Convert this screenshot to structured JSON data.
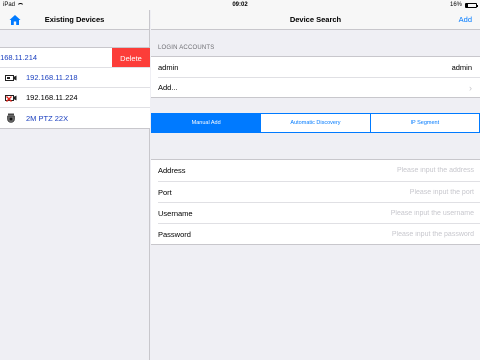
{
  "status_bar": {
    "carrier": "iPad",
    "time": "09:02",
    "battery": "16%",
    "battery_level": 0.16
  },
  "left": {
    "title": "Existing Devices",
    "devices": [
      {
        "label": ".168.11.214",
        "icon": "device-icon",
        "swiped": true,
        "delete_label": "Delete"
      },
      {
        "label": "192.168.11.218",
        "icon": "camera-icon"
      },
      {
        "label": "192.168.11.224",
        "icon": "camera-offline-icon"
      },
      {
        "label": "2M PTZ 22X",
        "icon": "ptz-dome-icon"
      }
    ]
  },
  "right": {
    "title": "Device Search",
    "add_label": "Add",
    "login_accounts": {
      "header": "LOGIN ACCOUNTS",
      "account_name": "admin",
      "account_value": "admin",
      "add_label": "Add..."
    },
    "segments": [
      {
        "label": "Manual Add",
        "active": true
      },
      {
        "label": "Automatic Discovery",
        "active": false
      },
      {
        "label": "IP Segment",
        "active": false
      }
    ],
    "form": {
      "address_label": "Address",
      "address_placeholder": "Please input the address",
      "port_label": "Port",
      "port_placeholder": "Please input the port",
      "username_label": "Username",
      "username_placeholder": "Please input the username",
      "password_label": "Password",
      "password_placeholder": "Please input the password"
    }
  },
  "colors": {
    "accent": "#007aff",
    "delete": "#fc3d39",
    "device_link": "#1a3fbf"
  }
}
